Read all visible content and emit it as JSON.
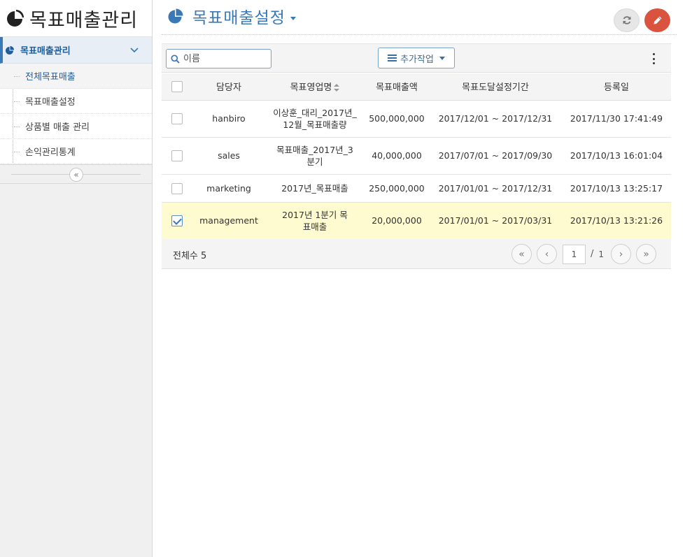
{
  "sidebar": {
    "app_title": "목표매출관리",
    "group_label": "목표매출관리",
    "items": [
      {
        "label": "전체목표매출"
      },
      {
        "label": "목표매출설정"
      },
      {
        "label": "상품별 매출 관리"
      },
      {
        "label": "손익관리통계"
      }
    ],
    "collapse_glyph": "«"
  },
  "header": {
    "title": "목표매출설정"
  },
  "toolbar": {
    "search_placeholder": "이름",
    "action_label": "추가작업"
  },
  "table": {
    "columns": [
      "담당자",
      "목표영업명",
      "목표매출액",
      "목표도달설정기간",
      "등록일"
    ],
    "rows": [
      {
        "checked": false,
        "manager": "hanbiro",
        "name": "이상훈_대리_2017년_12월_목표매출량",
        "amount": "500,000,000",
        "period": "2017/12/01 ~ 2017/12/31",
        "registered": "2017/11/30 17:41:49"
      },
      {
        "checked": false,
        "manager": "sales",
        "name": "목표매출_2017년_3분기",
        "amount": "40,000,000",
        "period": "2017/07/01 ~ 2017/09/30",
        "registered": "2017/10/13 16:01:04"
      },
      {
        "checked": false,
        "manager": "marketing",
        "name": "2017년_목표매출",
        "amount": "250,000,000",
        "period": "2017/01/01 ~ 2017/12/31",
        "registered": "2017/10/13 13:25:17"
      },
      {
        "checked": true,
        "manager": "management",
        "name": "2017년 1분기 목표매출",
        "amount": "20,000,000",
        "period": "2017/01/01 ~ 2017/03/31",
        "registered": "2017/10/13 13:21:26"
      }
    ]
  },
  "footer": {
    "total_label": "전체수 5",
    "page_current": "1",
    "page_sep": "/",
    "page_total": "1",
    "first_glyph": "«",
    "prev_glyph": "‹",
    "next_glyph": "›",
    "last_glyph": "»"
  },
  "colors": {
    "accent": "#3a78b8",
    "edit_button": "#d9533f",
    "selected_row": "#fdfbcf"
  },
  "icons": {
    "app": "pie-chart-icon",
    "refresh": "refresh-icon",
    "edit": "pencil-icon",
    "search": "search-icon",
    "menu": "bars-icon",
    "more": "kebab-icon"
  }
}
